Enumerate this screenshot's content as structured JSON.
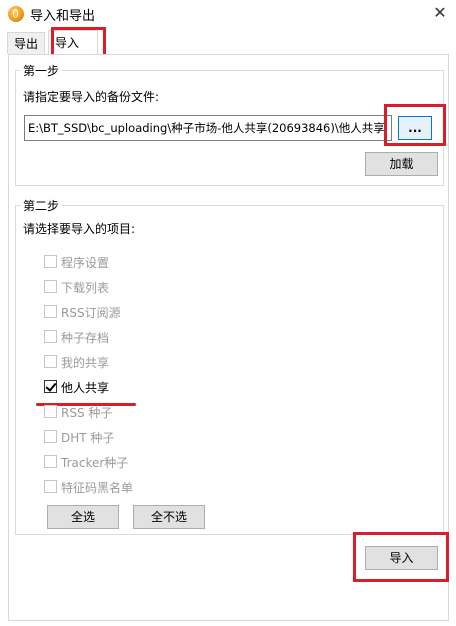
{
  "window": {
    "title": "导入和导出",
    "close_glyph": "✕"
  },
  "tabs": [
    {
      "label": "导出"
    },
    {
      "label": "导入"
    }
  ],
  "step1": {
    "title": "第一步",
    "prompt": "请指定要导入的备份文件:",
    "path_value": "E:\\BT_SSD\\bc_uploading\\种子市场-他人共享(20693846)\\他人共享",
    "browse_label": "...",
    "load_label": "加载"
  },
  "step2": {
    "title": "第二步",
    "prompt": "请选择要导入的项目:",
    "items": [
      {
        "label": "程序设置",
        "checked": false,
        "enabled": false
      },
      {
        "label": "下载列表",
        "checked": false,
        "enabled": false
      },
      {
        "label": "RSS订阅源",
        "checked": false,
        "enabled": false
      },
      {
        "label": "种子存档",
        "checked": false,
        "enabled": false
      },
      {
        "label": "我的共享",
        "checked": false,
        "enabled": false
      },
      {
        "label": "他人共享",
        "checked": true,
        "enabled": true
      },
      {
        "label": "RSS 种子",
        "checked": false,
        "enabled": false
      },
      {
        "label": "DHT 种子",
        "checked": false,
        "enabled": false
      },
      {
        "label": "Tracker种子",
        "checked": false,
        "enabled": false
      },
      {
        "label": "特征码黑名单",
        "checked": false,
        "enabled": false
      }
    ],
    "select_all_label": "全选",
    "select_none_label": "全不选"
  },
  "import_button_label": "导入",
  "highlight_color": "#d81e2a"
}
